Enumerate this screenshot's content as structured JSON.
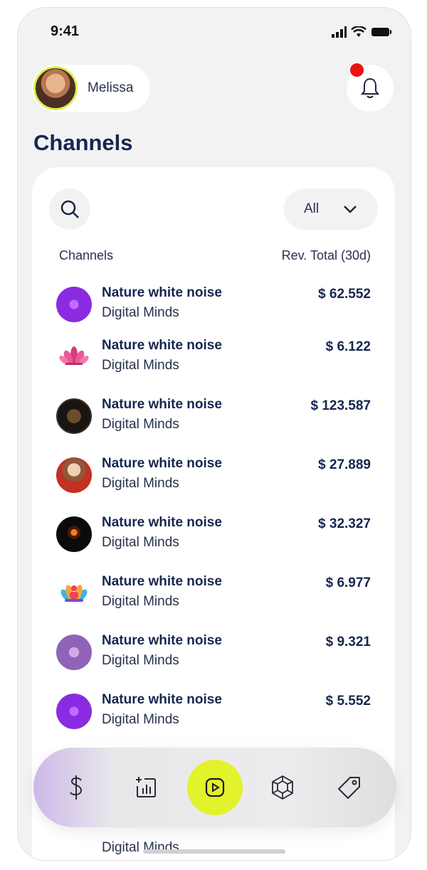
{
  "status_bar": {
    "time": "9:41"
  },
  "user": {
    "name": "Melissa"
  },
  "page": {
    "title": "Channels"
  },
  "filter": {
    "selected": "All"
  },
  "table": {
    "col_channels": "Channels",
    "col_revenue": "Rev. Total (30d)",
    "rows": [
      {
        "title": "Nature white noise",
        "subtitle": "Digital Minds",
        "value": "$ 62.552",
        "icon": "meditation-purple-icon"
      },
      {
        "title": "Nature white noise",
        "subtitle": "Digital Minds",
        "value": "$ 6.122",
        "icon": "lotus-icon"
      },
      {
        "title": "Nature white noise",
        "subtitle": "Digital Minds",
        "value": "$ 123.587",
        "icon": "emblem-dark-icon"
      },
      {
        "title": "Nature white noise",
        "subtitle": "Digital Minds",
        "value": "$ 27.889",
        "icon": "portrait-icon"
      },
      {
        "title": "Nature white noise",
        "subtitle": "Digital Minds",
        "value": "$ 32.327",
        "icon": "fire-icon"
      },
      {
        "title": "Nature white noise",
        "subtitle": "Digital Minds",
        "value": "$ 6.977",
        "icon": "yoga-lotus-icon"
      },
      {
        "title": "Nature white noise",
        "subtitle": "Digital Minds",
        "value": "$ 9.321",
        "icon": "meditation-violet-icon"
      },
      {
        "title": "Nature white noise",
        "subtitle": "Digital Minds",
        "value": "$ 5.552",
        "icon": "meditation-purple-icon"
      }
    ],
    "peek_subtitle": "Digital Minds"
  },
  "tab_bar": {
    "items": [
      "dollar-icon",
      "stats-icon",
      "play-icon",
      "network-icon",
      "tag-icon"
    ],
    "active": "play-icon",
    "active_color": "#e2f22b"
  },
  "colors": {
    "title": "#15264f",
    "notification": "#ee1111",
    "avatar_ring": "#d8f24a"
  }
}
